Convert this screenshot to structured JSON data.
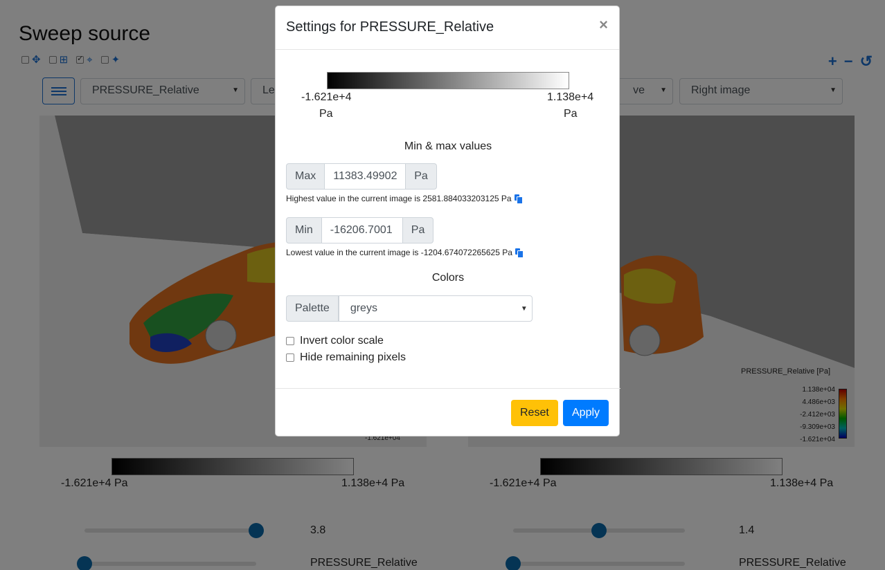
{
  "page": {
    "title": "Sweep source"
  },
  "toolbar": {
    "tools": [
      {
        "icon": "move-icon",
        "glyph": "✥",
        "checked": false
      },
      {
        "icon": "grid-icon",
        "glyph": "⊞",
        "checked": false
      },
      {
        "icon": "crosshair-icon",
        "glyph": "⌖",
        "checked": true
      },
      {
        "icon": "pin-icon",
        "glyph": "📌",
        "checked": false
      }
    ],
    "zoom_in": "+",
    "zoom_out": "−",
    "reset_view": "↺"
  },
  "selectors": {
    "left_variable": "PRESSURE_Relative",
    "left_image": "Le",
    "right_variable": "ve",
    "right_image": "Right image"
  },
  "left_view": {
    "legend_bottom_value": "-1.621e+04",
    "strip_min": "-1.621e+4  Pa",
    "strip_max": "1.138e+4  Pa",
    "slider1_value": "3.8",
    "slider1_fraction": 1.0,
    "slider2_value": "PRESSURE_Relative",
    "slider2_fraction": 0.0
  },
  "right_view": {
    "legend_title": "PRESSURE_Relative [Pa]",
    "legend_ticks": [
      "1.138e+04",
      "4.486e+03",
      "-2.412e+03",
      "-9.309e+03",
      "-1.621e+04"
    ],
    "strip_min": "-1.621e+4  Pa",
    "strip_max": "1.138e+4  Pa",
    "slider1_value": "1.4",
    "slider1_fraction": 0.5,
    "slider2_value": "PRESSURE_Relative",
    "slider2_fraction": 0.0
  },
  "modal": {
    "title": "Settings for PRESSURE_Relative",
    "close": "×",
    "scale_min": "-1.621e+4",
    "scale_max": "1.138e+4",
    "unit": "Pa",
    "minmax_heading": "Min & max values",
    "max_label": "Max",
    "max_value": "11383.49902",
    "max_unit": "Pa",
    "max_help": "Highest value in the current image is 2581.884033203125 Pa",
    "min_label": "Min",
    "min_value": "-16206.7001",
    "min_unit": "Pa",
    "min_help": "Lowest value in the current image is -1204.674072265625 Pa",
    "colors_heading": "Colors",
    "palette_label": "Palette",
    "palette_value": "greys",
    "invert_label": "Invert color scale",
    "invert_checked": false,
    "hide_label": "Hide remaining pixels",
    "hide_checked": false,
    "reset_label": "Reset",
    "apply_label": "Apply"
  },
  "colors": {
    "primary": "#007bff",
    "warning": "#ffc107",
    "icon_blue": "#1a6fd1"
  }
}
